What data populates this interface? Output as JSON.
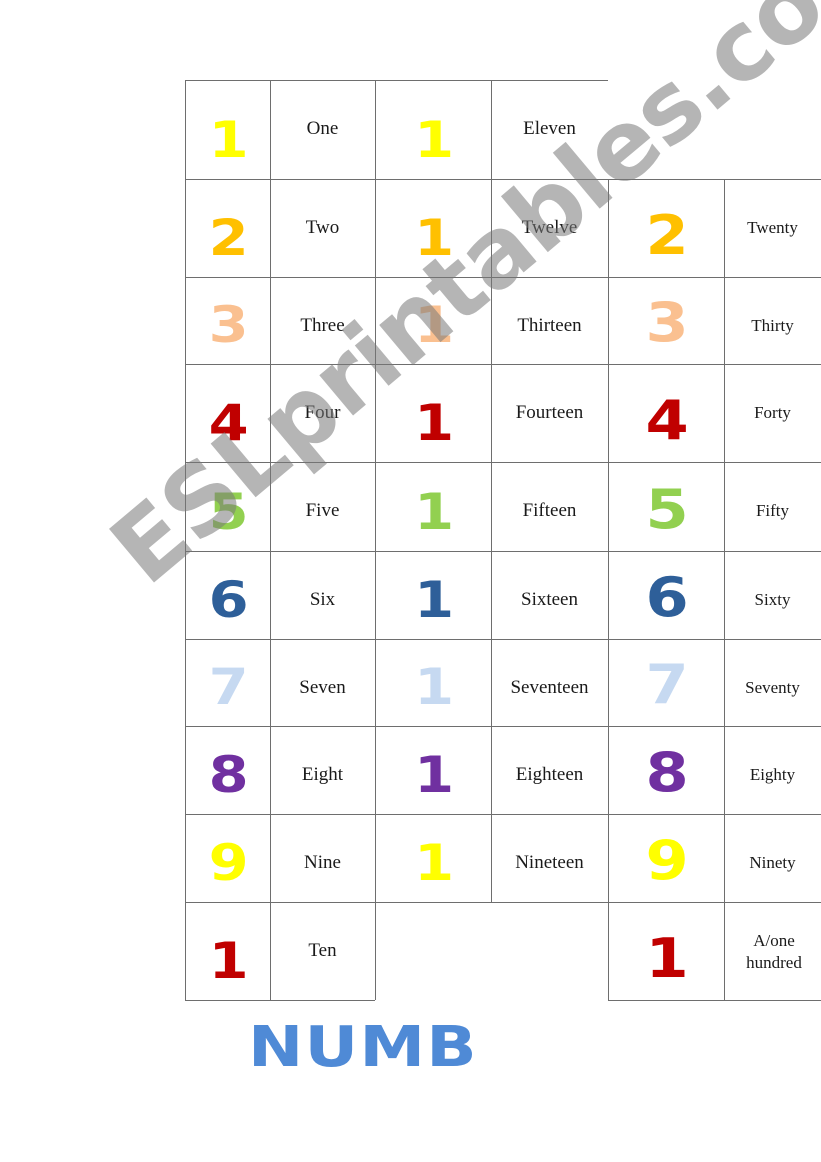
{
  "title": "NUMB",
  "watermark": "ESLprintables.com",
  "colors": {
    "yellow": "#ffff00",
    "amber": "#ffc000",
    "peach": "#fac090",
    "red": "#c00000",
    "green": "#92d050",
    "blue": "#2e5f99",
    "lightblue": "#c6d9f1",
    "purple": "#7030a0",
    "title_blue": "#4f8ad6"
  },
  "ones": [
    {
      "digit": "1",
      "word": "One",
      "color": "#ffff00"
    },
    {
      "digit": "2",
      "word": "Two",
      "color": "#ffc000"
    },
    {
      "digit": "3",
      "word": "Three",
      "color": "#fac090"
    },
    {
      "digit": "4",
      "word": "Four",
      "color": "#c00000"
    },
    {
      "digit": "5",
      "word": "Five",
      "color": "#92d050"
    },
    {
      "digit": "6",
      "word": "Six",
      "color": "#2e5f99"
    },
    {
      "digit": "7",
      "word": "Seven",
      "color": "#c6d9f1"
    },
    {
      "digit": "8",
      "word": "Eight",
      "color": "#7030a0"
    },
    {
      "digit": "9",
      "word": "Nine",
      "color": "#ffff00"
    },
    {
      "digit": "1",
      "word": "Ten",
      "color": "#c00000"
    }
  ],
  "teens": [
    {
      "digit": "1",
      "word": "Eleven",
      "color": "#ffff00"
    },
    {
      "digit": "1",
      "word": "Twelve",
      "color": "#ffc000"
    },
    {
      "digit": "1",
      "word": "Thirteen",
      "color": "#fac090"
    },
    {
      "digit": "1",
      "word": "Fourteen",
      "color": "#c00000"
    },
    {
      "digit": "1",
      "word": "Fifteen",
      "color": "#92d050"
    },
    {
      "digit": "1",
      "word": "Sixteen",
      "color": "#2e5f99"
    },
    {
      "digit": "1",
      "word": "Seventeen",
      "color": "#c6d9f1"
    },
    {
      "digit": "1",
      "word": "Eighteen",
      "color": "#7030a0"
    },
    {
      "digit": "1",
      "word": "Nineteen",
      "color": "#ffff00"
    }
  ],
  "tens": [
    {
      "digit": "2",
      "word": "Twenty",
      "color": "#ffc000"
    },
    {
      "digit": "3",
      "word": "Thirty",
      "color": "#fac090"
    },
    {
      "digit": "4",
      "word": "Forty",
      "color": "#c00000"
    },
    {
      "digit": "5",
      "word": "Fifty",
      "color": "#92d050"
    },
    {
      "digit": "6",
      "word": "Sixty",
      "color": "#2e5f99"
    },
    {
      "digit": "7",
      "word": "Seventy",
      "color": "#c6d9f1"
    },
    {
      "digit": "8",
      "word": "Eighty",
      "color": "#7030a0"
    },
    {
      "digit": "9",
      "word": "Ninety",
      "color": "#ffff00"
    },
    {
      "digit": "1",
      "word": "A/one hundred",
      "color": "#c00000"
    }
  ]
}
